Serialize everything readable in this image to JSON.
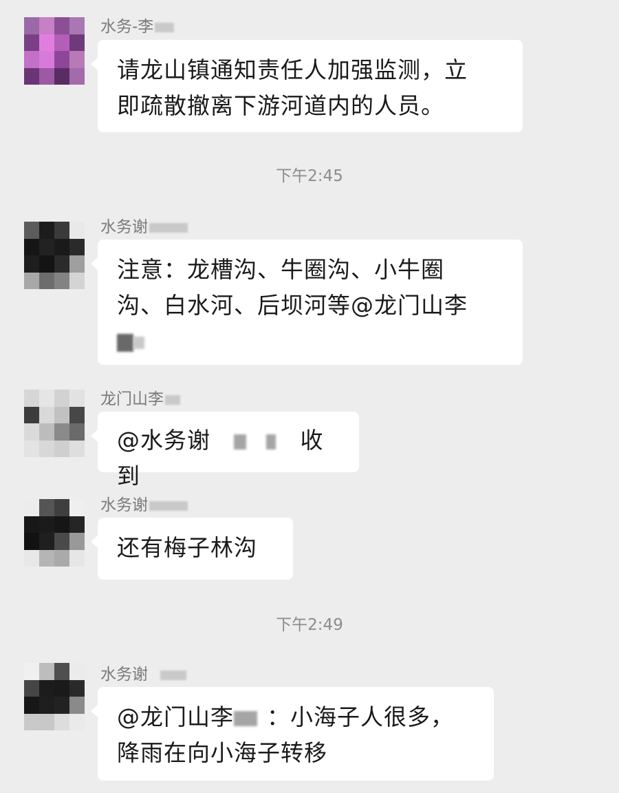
{
  "messages": [
    {
      "sender": "水务-李",
      "lines": [
        "请龙山镇通知责任人加强监测，立",
        "即疏散撤离下游河道内的人员。"
      ]
    },
    {
      "time": "下午2:45"
    },
    {
      "sender": "水务谢",
      "lines": [
        "注意：龙槽沟、牛圈沟、小牛圈",
        "沟、白水河、后坝河等@龙门山李"
      ]
    },
    {
      "sender": "龙门山李",
      "text_before": "@水务谢",
      "text_after": "收到"
    },
    {
      "sender": "水务谢",
      "text": "还有梅子林沟"
    },
    {
      "time": "下午2:49"
    },
    {
      "sender": "水务谢",
      "line1_before": "@龙门山李",
      "line1_after": "：小海子人很多，",
      "line2": "降雨在向小海子转移"
    }
  ]
}
